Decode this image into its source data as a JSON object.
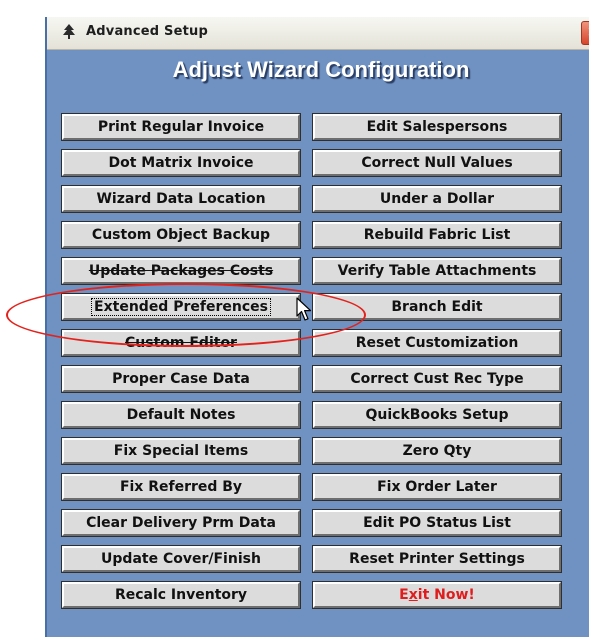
{
  "window": {
    "title": "Advanced Setup",
    "close_label": "✕",
    "heading": "Adjust Wizard Configuration"
  },
  "buttons": {
    "left": [
      "Print Regular Invoice",
      "Dot Matrix Invoice",
      "Wizard Data Location",
      "Custom Object Backup",
      "Update Packages Costs",
      "Extended Preferences",
      "Custom Editor",
      "Proper Case Data",
      "Default Notes",
      "Fix Special Items",
      "Fix Referred By",
      "Clear Delivery Prm Data",
      "Update Cover/Finish",
      "Recalc Inventory"
    ],
    "right": [
      "Edit Salespersons",
      "Correct Null Values",
      "Under a Dollar",
      "Rebuild Fabric List",
      "Verify Table Attachments",
      "Branch Edit",
      "Reset Customization",
      "Correct Cust Rec Type",
      "QuickBooks Setup",
      "Zero Qty",
      "Fix Order Later",
      "Edit PO Status List",
      "Reset Printer Settings"
    ],
    "exit": {
      "prefix": "E",
      "underlined": "x",
      "suffix": "it Now!"
    }
  },
  "colors": {
    "dialog_background": "#6f92c2",
    "highlight_ellipse": "#e3221c",
    "exit_text": "#e01c1c"
  },
  "icons": {
    "app": "app-tree-icon",
    "cursor": "mouse-pointer-icon"
  }
}
